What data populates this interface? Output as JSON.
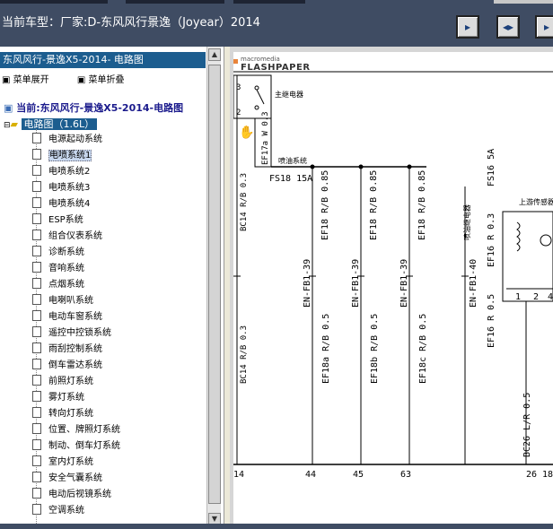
{
  "window_title": "当前车型：厂家:D-东风风行景逸（Joyear）2014",
  "toolbar_buttons": [
    {
      "name": "prev-page-icon",
      "glyph": "▸"
    },
    {
      "name": "fit-page-icon",
      "glyph": "◂▸"
    },
    {
      "name": "next-page-icon",
      "glyph": "▸"
    }
  ],
  "sidebar": {
    "header": "东风风行-景逸X5-2014- 电路图",
    "expand_label": "菜单展开",
    "collapse_label": "菜单折叠",
    "root_label": "当前:东风风行-景逸X5-2014-电路图",
    "folder_label": "电路图（1.6L）",
    "items": [
      "电源起动系统",
      "电喷系统1",
      "电喷系统2",
      "电喷系统3",
      "电喷系统4",
      "ESP系统",
      "组合仪表系统",
      "诊断系统",
      "音响系统",
      "点烟系统",
      "电喇叭系统",
      "电动车窗系统",
      "遥控中控锁系统",
      "雨刮控制系统",
      "倒车雷达系统",
      "前照灯系统",
      "雾灯系统",
      "转向灯系统",
      "位置、牌照灯系统",
      "制动、倒车灯系统",
      "室内灯系统",
      "安全气囊系统",
      "电动后视镜系统",
      "空调系统"
    ],
    "selected_index": 1
  },
  "viewer": {
    "logo_small": "macromedia",
    "logo_big": "FLASHPAPER",
    "labels": {
      "relay_main": "主继电器",
      "relay_oil": "喷油系统",
      "ef17": "EF17a W 0.3",
      "fs18": "FS18 15A",
      "bc14a": "BC14 R/B 0.3",
      "ef18r1": "EF18 R/B 0.85",
      "ef18r2": "EF18 R/B 0.85",
      "ef18r3": "EF18 R/B 0.85",
      "ef18r4": "EF18 R/B 0.85",
      "fs16": "FS16 5A",
      "ef16a": "EF16 R 0.3",
      "upper_sensor": "上游传感器",
      "relay_tag": "喷油继电器",
      "enfb1": "EN-FB1-39",
      "enfb2": "EN-FB1-39",
      "enfb3": "EN-FB1-39",
      "enfb4": "EN-FB1-40",
      "ef16b": "EF16 R 0.5",
      "bc14b": "BC14 R/B 0.3",
      "ef18a": "EF18a R/B 0.5",
      "ef18b": "EF18b R/B 0.5",
      "ef18c": "EF18c R/B 0.5",
      "bc26": "BC26 L/R 0.5",
      "pin1": "1",
      "pin2": "2",
      "pin4": "4",
      "pin1b": "1",
      "pin2b": "2",
      "pin3b": "3",
      "pin4b": "4",
      "bottom_pins": [
        "14",
        "44",
        "45",
        "63",
        "26",
        "18"
      ]
    }
  }
}
